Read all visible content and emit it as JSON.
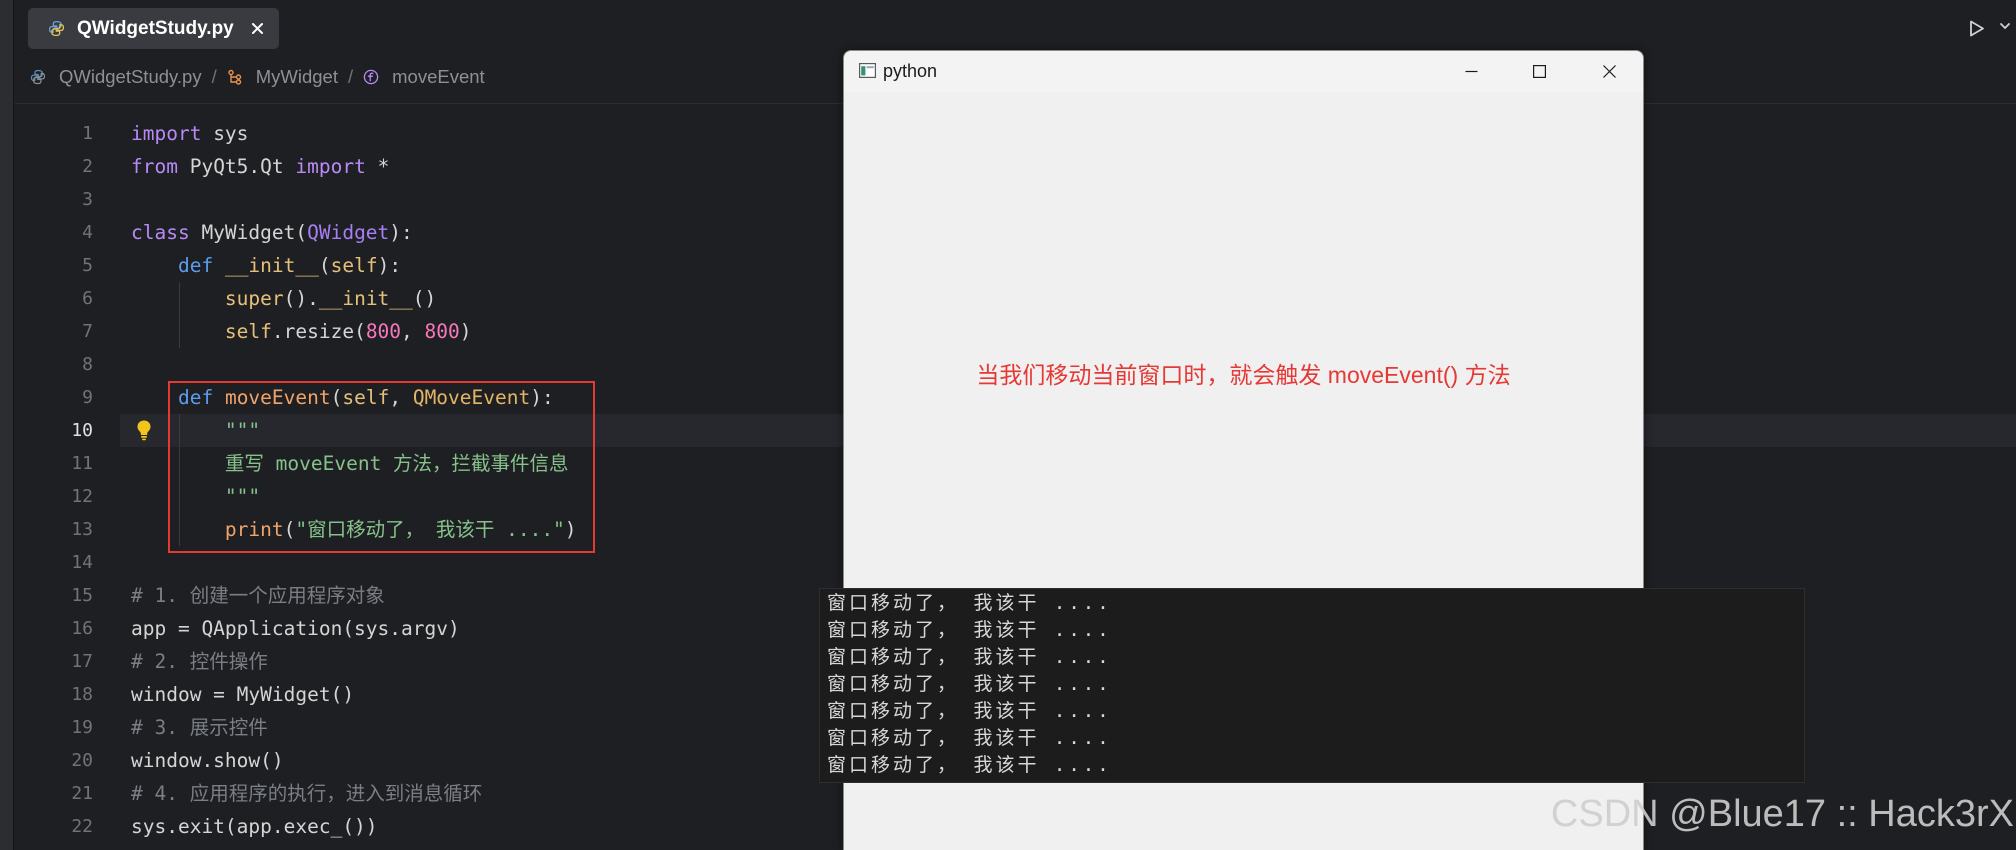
{
  "theme": {
    "editor_bg": "#1e1f22",
    "window_bg": "#f0f0f0",
    "annotation": "#e53935"
  },
  "editor": {
    "tab": {
      "label": "QWidgetStudy.py",
      "icon": "python-file-icon",
      "close_icon": "close-icon"
    },
    "toolbar": {
      "run_icon": "run-icon",
      "run_menu_icon": "chevron-down-icon"
    },
    "breadcrumb": {
      "separator": "/",
      "items": [
        {
          "label": "QWidgetStudy.py",
          "icon": "python-file-icon"
        },
        {
          "label": "MyWidget",
          "icon": "class-icon"
        },
        {
          "label": "moveEvent",
          "icon": "function-icon"
        }
      ]
    },
    "current_line": 10,
    "lines": [
      {
        "n": "1",
        "tokens": [
          [
            "kw",
            "import"
          ],
          [
            "plain",
            " sys"
          ]
        ]
      },
      {
        "n": "2",
        "tokens": [
          [
            "kw",
            "from"
          ],
          [
            "plain",
            " PyQt5.Qt "
          ],
          [
            "kw",
            "import"
          ],
          [
            "plain",
            " *"
          ]
        ]
      },
      {
        "n": "3",
        "tokens": []
      },
      {
        "n": "4",
        "tokens": [
          [
            "kw",
            "class"
          ],
          [
            "plain",
            " MyWidget("
          ],
          [
            "cls",
            "QWidget"
          ],
          [
            "plain",
            "):"
          ]
        ]
      },
      {
        "n": "5",
        "tokens": [
          [
            "plain",
            "    "
          ],
          [
            "def",
            "def"
          ],
          [
            "plain",
            " "
          ],
          [
            "magic",
            "__init__"
          ],
          [
            "plain",
            "("
          ],
          [
            "self",
            "self"
          ],
          [
            "plain",
            "):"
          ]
        ]
      },
      {
        "n": "6",
        "tokens": [
          [
            "plain",
            "        "
          ],
          [
            "builtin",
            "super"
          ],
          [
            "plain",
            "()."
          ],
          [
            "magic",
            "__init__"
          ],
          [
            "plain",
            "()"
          ]
        ]
      },
      {
        "n": "7",
        "tokens": [
          [
            "plain",
            "        "
          ],
          [
            "self",
            "self"
          ],
          [
            "plain",
            ".resize("
          ],
          [
            "num",
            "800"
          ],
          [
            "plain",
            ", "
          ],
          [
            "num",
            "800"
          ],
          [
            "plain",
            ")"
          ]
        ]
      },
      {
        "n": "8",
        "tokens": []
      },
      {
        "n": "9",
        "tokens": [
          [
            "plain",
            "    "
          ],
          [
            "def",
            "def"
          ],
          [
            "plain",
            " "
          ],
          [
            "fn",
            "moveEvent"
          ],
          [
            "plain",
            "("
          ],
          [
            "self",
            "self"
          ],
          [
            "plain",
            ", "
          ],
          [
            "param",
            "QMoveEvent"
          ],
          [
            "plain",
            "):"
          ]
        ]
      },
      {
        "n": "10",
        "tokens": [
          [
            "plain",
            "        "
          ],
          [
            "str",
            "\"\"\""
          ]
        ]
      },
      {
        "n": "11",
        "tokens": [
          [
            "plain",
            "        "
          ],
          [
            "str",
            "重写 moveEvent 方法，拦截事件信息"
          ]
        ]
      },
      {
        "n": "12",
        "tokens": [
          [
            "plain",
            "        "
          ],
          [
            "str",
            "\"\"\""
          ]
        ]
      },
      {
        "n": "13",
        "tokens": [
          [
            "plain",
            "        "
          ],
          [
            "fn",
            "print"
          ],
          [
            "plain",
            "("
          ],
          [
            "str",
            "\"窗口移动了， 我该干 ....\""
          ],
          [
            "plain",
            ")"
          ]
        ]
      },
      {
        "n": "14",
        "tokens": []
      },
      {
        "n": "15",
        "tokens": [
          [
            "cmt",
            "# 1. 创建一个应用程序对象"
          ]
        ]
      },
      {
        "n": "16",
        "tokens": [
          [
            "plain",
            "app = QApplication(sys.argv)"
          ]
        ]
      },
      {
        "n": "17",
        "tokens": [
          [
            "cmt",
            "# 2. 控件操作"
          ]
        ]
      },
      {
        "n": "18",
        "tokens": [
          [
            "plain",
            "window = MyWidget()"
          ]
        ]
      },
      {
        "n": "19",
        "tokens": [
          [
            "cmt",
            "# 3. 展示控件"
          ]
        ]
      },
      {
        "n": "20",
        "tokens": [
          [
            "plain",
            "window.show()"
          ]
        ]
      },
      {
        "n": "21",
        "tokens": [
          [
            "cmt",
            "# 4. 应用程序的执行，进入到消息循环"
          ]
        ]
      },
      {
        "n": "22",
        "tokens": [
          [
            "plain",
            "sys.exit(app.exec_())"
          ]
        ]
      }
    ]
  },
  "app_window": {
    "title": "python",
    "icon": "app-window-icon",
    "controls": [
      "minimize-icon",
      "maximize-icon",
      "close-icon"
    ],
    "message": "当我们移动当前窗口时，就会触发 moveEvent() 方法"
  },
  "console": {
    "lines": [
      "窗口移动了， 我该干 ....",
      "窗口移动了， 我该干 ....",
      "窗口移动了， 我该干 ....",
      "窗口移动了， 我该干 ....",
      "窗口移动了， 我该干 ....",
      "窗口移动了， 我该干 ....",
      "窗口移动了， 我该干 ...."
    ]
  },
  "watermark": "CSDN @Blue17 :: Hack3rX"
}
